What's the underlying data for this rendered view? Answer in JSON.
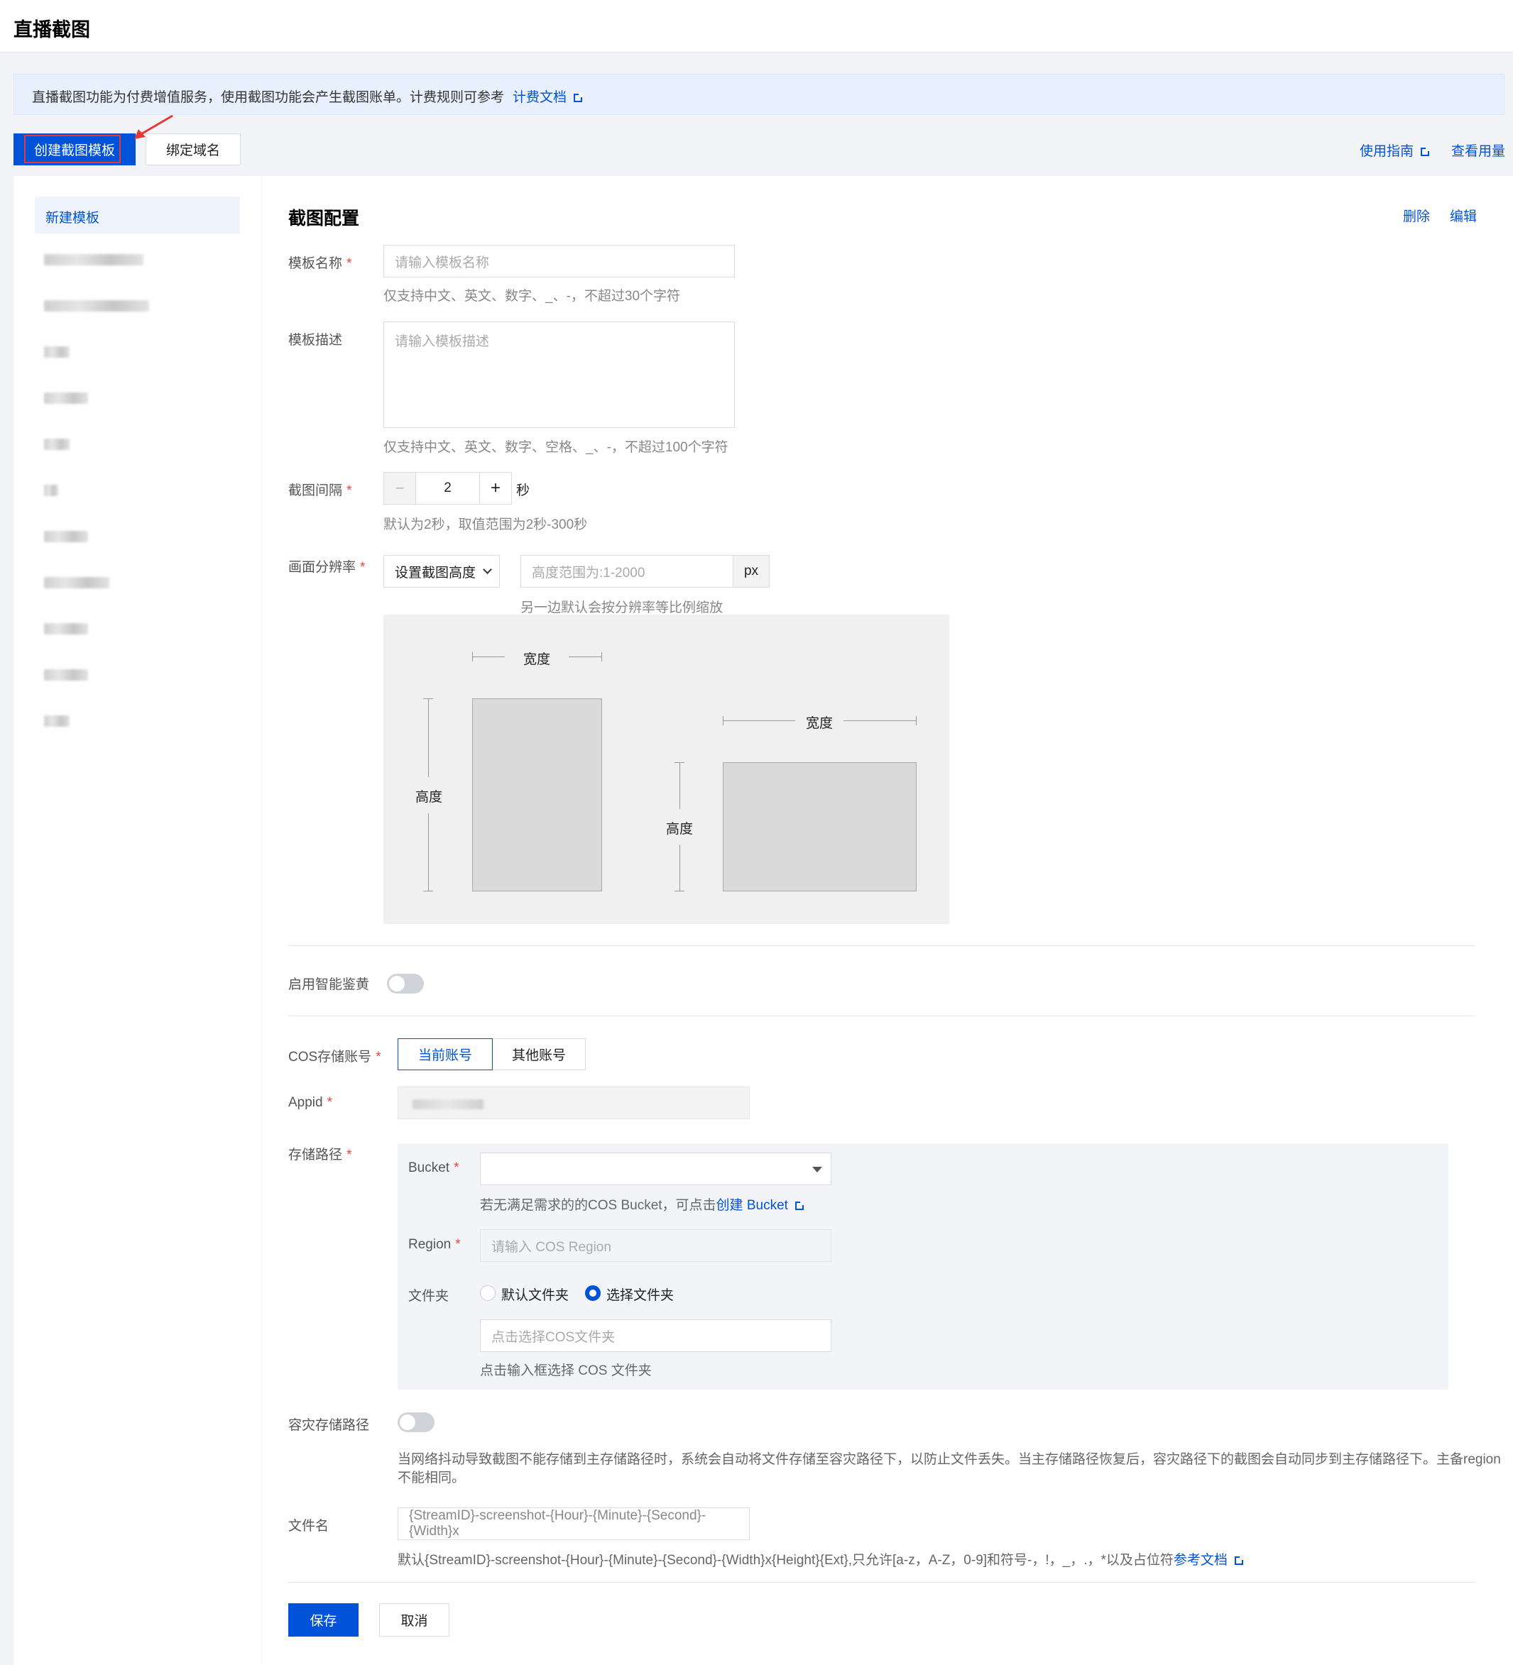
{
  "header": {
    "title": "直播截图"
  },
  "notice": {
    "text": "直播截图功能为付费增值服务，使用截图功能会产生截图账单。计费规则可参考",
    "link": "计费文档"
  },
  "toolbar": {
    "create_template": "创建截图模板",
    "bind_domain": "绑定域名",
    "guide": "使用指南",
    "usage": "查看用量"
  },
  "sidebar": {
    "active_item": "新建模板"
  },
  "form": {
    "section_title": "截图配置",
    "delete": "删除",
    "edit": "编辑",
    "name_label": "模板名称",
    "name_placeholder": "请输入模板名称",
    "name_hint": "仅支持中文、英文、数字、_、-，不超过30个字符",
    "desc_label": "模板描述",
    "desc_placeholder": "请输入模板描述",
    "desc_hint": "仅支持中文、英文、数字、空格、_、-，不超过100个字符",
    "interval_label": "截图间隔",
    "interval_value": "2",
    "interval_minus": "–",
    "interval_plus": "+",
    "interval_unit": "秒",
    "interval_hint": "默认为2秒，取值范围为2秒-300秒",
    "resolution_label": "画面分辨率",
    "resolution_select": "设置截图高度",
    "resolution_placeholder": "高度范围为:1-2000",
    "resolution_unit": "px",
    "resolution_hint": "另一边默认会按分辨率等比例缩放",
    "diagram_width_1": "宽度",
    "diagram_height_1": "高度",
    "diagram_width_2": "宽度",
    "diagram_height_2": "高度",
    "smart_label": "启用智能鉴黄",
    "cos_label": "COS存储账号",
    "cos_current": "当前账号",
    "cos_other": "其他账号",
    "appid_label": "Appid",
    "path_label": "存储路径",
    "bucket_label": "Bucket",
    "bucket_hint": "若无满足需求的的COS Bucket，可点击",
    "bucket_link": "创建 Bucket",
    "region_label": "Region",
    "region_placeholder": "请输入 COS Region",
    "folder_label": "文件夹",
    "folder_default": "默认文件夹",
    "folder_choose": "选择文件夹",
    "folder_placeholder": "点击选择COS文件夹",
    "folder_hint": "点击输入框选择 COS 文件夹",
    "backup_label": "容灾存储路径",
    "backup_hint_1": "当网络抖动导致截图不能存储到主存储路径时，系统会自动将文件存储至容灾路径下，以防止文件丢失。当主存储路径恢复后，容灾路径下的截图会自动同步到主存储路径下。主备region",
    "backup_hint_2": "不能相同。",
    "filename_label": "文件名",
    "filename_value": "{StreamID}-screenshot-{Hour}-{Minute}-{Second}-{Width}x",
    "filename_hint": "默认{StreamID}-screenshot-{Hour}-{Minute}-{Second}-{Width}x{Height}{Ext},只允许[a-z，A-Z，0-9]和符号-，!，_，.，*以及占位符",
    "filename_link": "参考文档",
    "save": "保存",
    "cancel": "取消"
  },
  "colors": {
    "primary": "#0052d9",
    "required": "#e54545",
    "annotation": "#e53935"
  }
}
